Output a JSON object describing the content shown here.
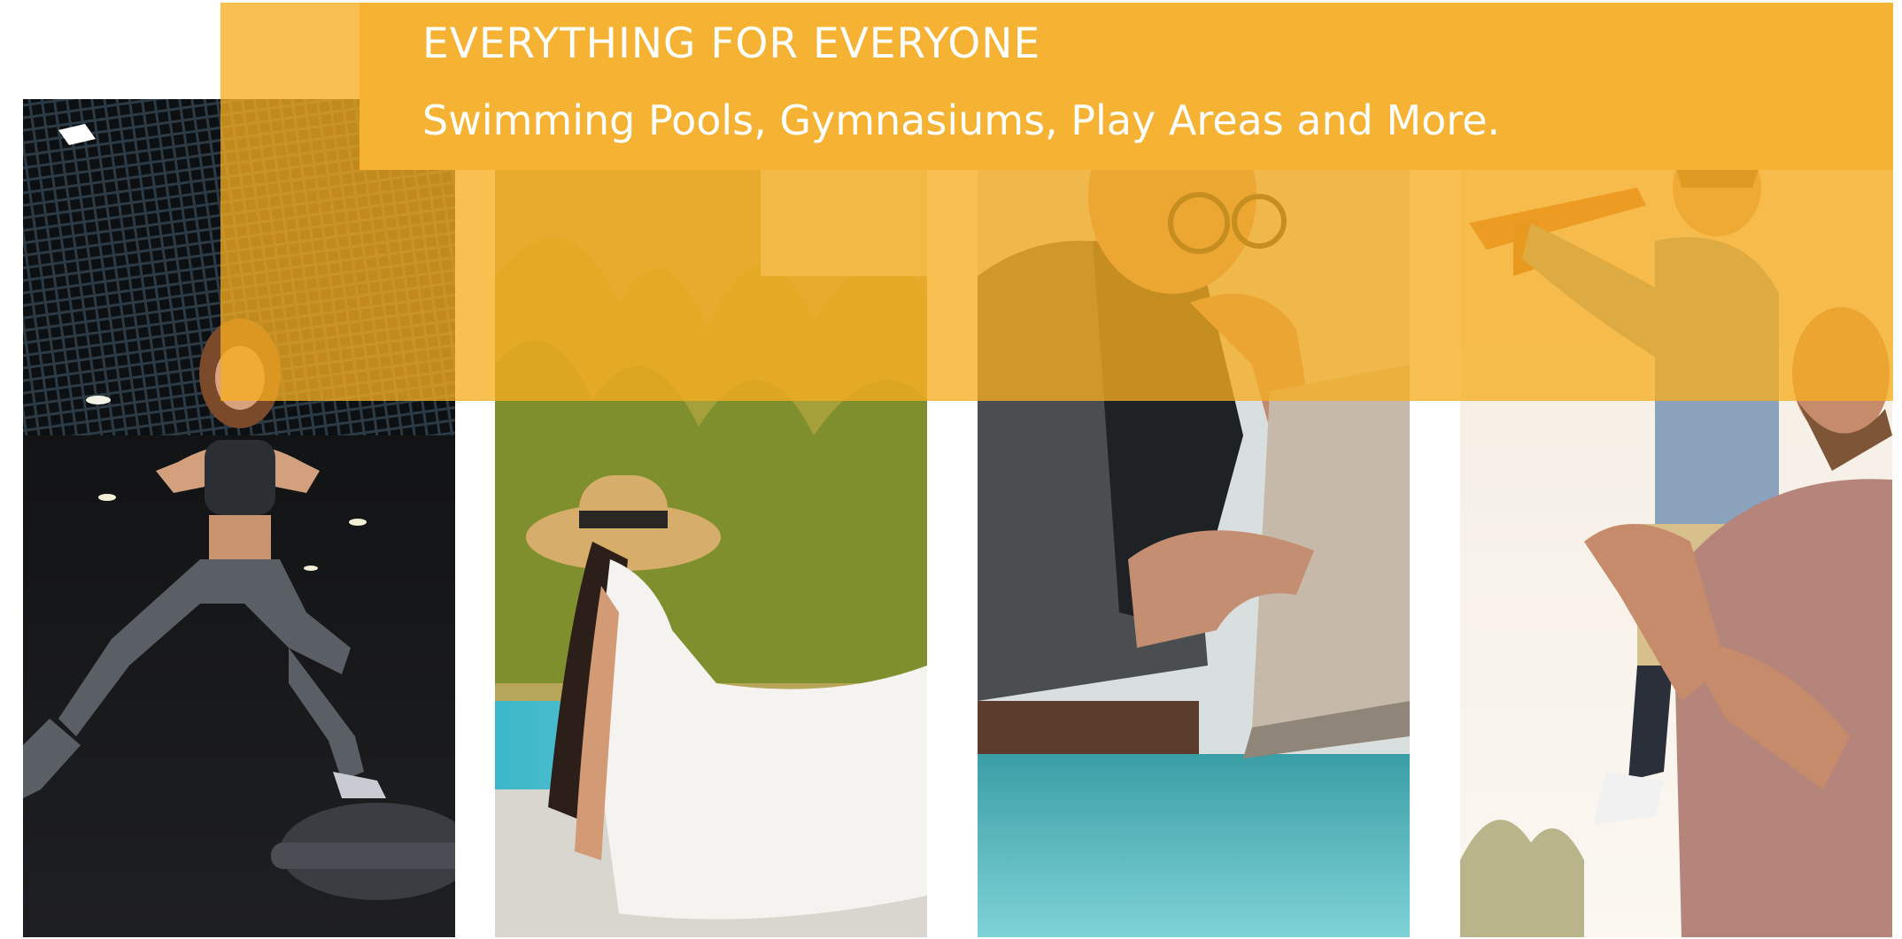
{
  "banner": {
    "headline": "EVERYTHING FOR EVERYONE",
    "subline": "Swimming Pools, Gymnasiums, Play Areas and More."
  },
  "colors": {
    "accent_orange": "#f6b232",
    "overlay_orange": "#f6ad20",
    "text": "#ffffff"
  },
  "photos": [
    {
      "subject": "woman-exercising-gym-photo"
    },
    {
      "subject": "woman-sun-hat-poolside-photo"
    },
    {
      "subject": "man-glasses-laptop-photo"
    },
    {
      "subject": "father-child-toy-plane-photo"
    }
  ]
}
